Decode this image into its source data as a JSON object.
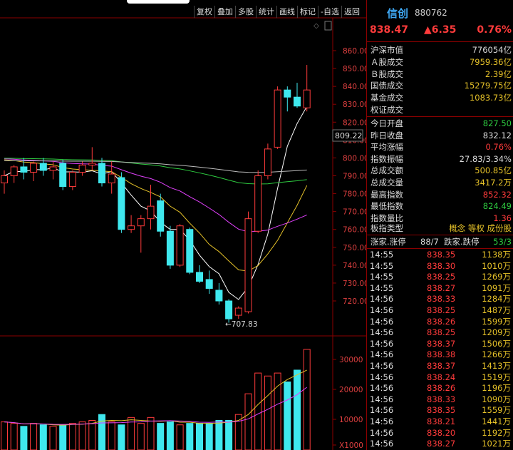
{
  "toolbar": {
    "items": [
      "复权",
      "叠加",
      "多股",
      "统计",
      "画线",
      "标记",
      "-自选",
      "返回"
    ]
  },
  "chart": {
    "price_axis": [
      "860.00",
      "850.00",
      "840.00",
      "830.00",
      "820.00",
      "810.00",
      "800.00",
      "790.00",
      "780.00",
      "770.00",
      "760.00",
      "750.00",
      "740.00",
      "730.00",
      "720.00"
    ],
    "price_axis_values": [
      860,
      850,
      840,
      830,
      820,
      810,
      800,
      790,
      780,
      770,
      760,
      750,
      740,
      730,
      720
    ],
    "current_price_label": "809.22",
    "current_price": 809.22,
    "low_label": "←707.83",
    "low_value": 707.83,
    "volume_axis": [
      "30000",
      "20000",
      "10000",
      "X1000"
    ],
    "colors": {
      "up": "#ff3b3b",
      "down": "#3fe8ee",
      "ma5": "#ffffff",
      "ma10": "#e6c229",
      "ma20": "#e040fb",
      "ma60": "#2ecc40",
      "ma120": "#bbbbbb",
      "separator": "#8b0000"
    }
  },
  "chart_data": {
    "type": "candlestick",
    "ylim": [
      705,
      865
    ],
    "candles": [
      {
        "o": 786,
        "h": 793,
        "l": 780,
        "c": 790
      },
      {
        "o": 790,
        "h": 796,
        "l": 786,
        "c": 795
      },
      {
        "o": 795,
        "h": 800,
        "l": 788,
        "c": 792
      },
      {
        "o": 792,
        "h": 798,
        "l": 787,
        "c": 797
      },
      {
        "o": 797,
        "h": 800,
        "l": 790,
        "c": 793
      },
      {
        "o": 793,
        "h": 798,
        "l": 788,
        "c": 795
      },
      {
        "o": 797,
        "h": 799,
        "l": 782,
        "c": 784
      },
      {
        "o": 784,
        "h": 793,
        "l": 782,
        "c": 792
      },
      {
        "o": 792,
        "h": 798,
        "l": 790,
        "c": 796
      },
      {
        "o": 796,
        "h": 806,
        "l": 793,
        "c": 797
      },
      {
        "o": 797,
        "h": 800,
        "l": 784,
        "c": 786
      },
      {
        "o": 786,
        "h": 798,
        "l": 780,
        "c": 791
      },
      {
        "o": 789,
        "h": 792,
        "l": 758,
        "c": 760
      },
      {
        "o": 760,
        "h": 768,
        "l": 758,
        "c": 762
      },
      {
        "o": 762,
        "h": 768,
        "l": 747,
        "c": 766
      },
      {
        "o": 766,
        "h": 785,
        "l": 760,
        "c": 773
      },
      {
        "o": 776,
        "h": 780,
        "l": 756,
        "c": 759
      },
      {
        "o": 759,
        "h": 762,
        "l": 738,
        "c": 740
      },
      {
        "o": 740,
        "h": 763,
        "l": 739,
        "c": 762
      },
      {
        "o": 760,
        "h": 761,
        "l": 735,
        "c": 736
      },
      {
        "o": 736,
        "h": 740,
        "l": 730,
        "c": 731
      },
      {
        "o": 732,
        "h": 737,
        "l": 724,
        "c": 727
      },
      {
        "o": 726,
        "h": 730,
        "l": 718,
        "c": 720
      },
      {
        "o": 720,
        "h": 721,
        "l": 707.83,
        "c": 710
      },
      {
        "o": 712,
        "h": 717,
        "l": 710,
        "c": 716
      },
      {
        "o": 714,
        "h": 770,
        "l": 713,
        "c": 766
      },
      {
        "o": 759,
        "h": 793,
        "l": 758,
        "c": 790
      },
      {
        "o": 790,
        "h": 808,
        "l": 788,
        "c": 805
      },
      {
        "o": 806,
        "h": 840,
        "l": 805,
        "c": 838
      },
      {
        "o": 838,
        "h": 840,
        "l": 826,
        "c": 834
      },
      {
        "o": 834,
        "h": 842,
        "l": 828,
        "c": 829
      },
      {
        "o": 828,
        "h": 852,
        "l": 826,
        "c": 838
      }
    ],
    "volume": [
      9500,
      9000,
      8000,
      9000,
      8500,
      8000,
      8500,
      9000,
      9500,
      10000,
      12000,
      9500,
      8500,
      11000,
      9000,
      11000,
      9000,
      9500,
      8500,
      9000,
      9000,
      9000,
      10000,
      10000,
      12000,
      19000,
      26000,
      25000,
      26000,
      23000,
      27000,
      34000
    ]
  },
  "panel": {
    "name": "信创",
    "code": "880762",
    "price": "838.47",
    "change": "▲6.35",
    "change_pct": "0.76%",
    "stats": [
      {
        "label": "沪深市值",
        "value": "776054亿",
        "color": "white"
      },
      {
        "label": "Ａ股成交",
        "value": "7959.36亿",
        "color": "yellow"
      },
      {
        "label": "Ｂ股成交",
        "value": "2.39亿",
        "color": "yellow"
      },
      {
        "label": "国债成交",
        "value": "15279.75亿",
        "color": "yellow"
      },
      {
        "label": "基金成交",
        "value": "1083.73亿",
        "color": "yellow"
      },
      {
        "label": "权证成交",
        "value": "",
        "color": "yellow"
      }
    ],
    "stats2": [
      {
        "label": "今日开盘",
        "value": "827.50",
        "color": "green"
      },
      {
        "label": "昨日收盘",
        "value": "832.12",
        "color": "white"
      },
      {
        "label": "平均涨幅",
        "value": "0.76%",
        "color": "red"
      },
      {
        "label": "指数振幅",
        "value": "27.83/3.34%",
        "color": "white"
      },
      {
        "label": "总成交额",
        "value": "500.85亿",
        "color": "yellow"
      },
      {
        "label": "总成交量",
        "value": "3417.2万",
        "color": "yellow"
      },
      {
        "label": "最高指数",
        "value": "852.32",
        "color": "red"
      },
      {
        "label": "最低指数",
        "value": "824.49",
        "color": "green"
      },
      {
        "label": "指数量比",
        "value": "1.36",
        "color": "red"
      }
    ],
    "type_label": "板指类型",
    "type_value": "概念 等权 成份股",
    "limit_up_label": "涨家.涨停",
    "limit_up_value": "88/7",
    "limit_down_label": "跌家.跌停",
    "limit_down_value": "53/3",
    "ticks": [
      {
        "t": "14:55",
        "p": "838.35",
        "v": "1138万"
      },
      {
        "t": "14:55",
        "p": "838.30",
        "v": "1010万"
      },
      {
        "t": "14:55",
        "p": "838.25",
        "v": "1269万"
      },
      {
        "t": "14:55",
        "p": "838.27",
        "v": "1091万"
      },
      {
        "t": "14:56",
        "p": "838.33",
        "v": "1284万"
      },
      {
        "t": "14:56",
        "p": "838.25",
        "v": "1487万"
      },
      {
        "t": "14:56",
        "p": "838.26",
        "v": "1599万"
      },
      {
        "t": "14:56",
        "p": "838.25",
        "v": "1209万"
      },
      {
        "t": "14:56",
        "p": "838.37",
        "v": "1506万"
      },
      {
        "t": "14:56",
        "p": "838.38",
        "v": "1266万"
      },
      {
        "t": "14:56",
        "p": "838.37",
        "v": "1413万"
      },
      {
        "t": "14:56",
        "p": "838.24",
        "v": "1519万"
      },
      {
        "t": "14:56",
        "p": "838.26",
        "v": "1196万"
      },
      {
        "t": "14:56",
        "p": "838.33",
        "v": "1090万"
      },
      {
        "t": "14:56",
        "p": "838.35",
        "v": "1559万"
      },
      {
        "t": "14:56",
        "p": "838.21",
        "v": "1441万"
      },
      {
        "t": "14:56",
        "p": "838.20",
        "v": "1192万"
      },
      {
        "t": "14:56",
        "p": "838.27",
        "v": "1021万"
      }
    ]
  }
}
